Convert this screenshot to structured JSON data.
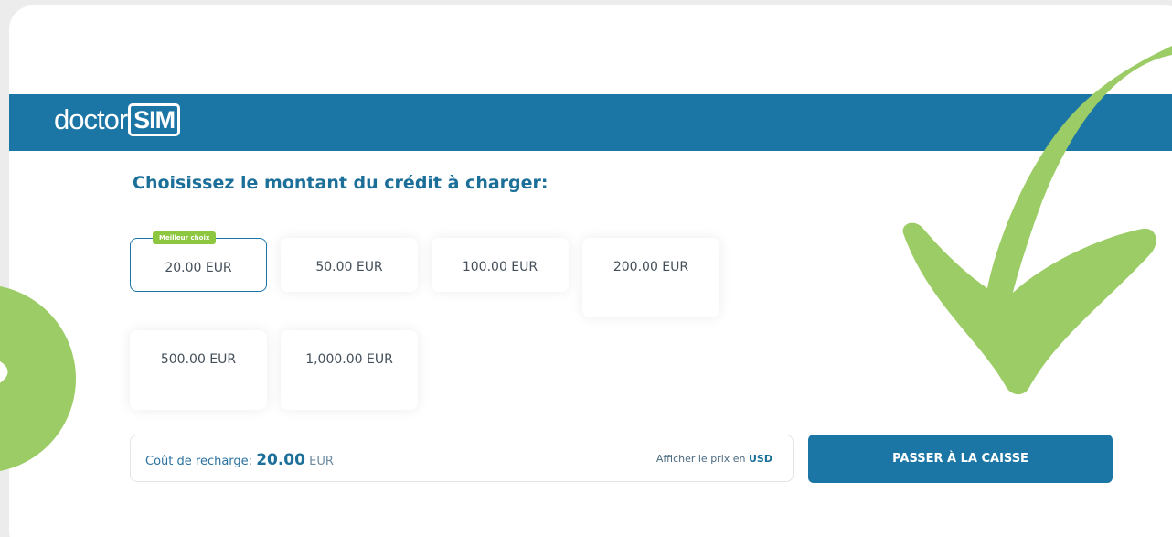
{
  "brand": {
    "name_plain": "doctor",
    "name_boxed": "SIM"
  },
  "heading": "Choisissez le montant du crédit à charger:",
  "amounts": [
    {
      "label": "20.00 EUR",
      "badge": "Meilleur choix",
      "selected": true
    },
    {
      "label": "50.00 EUR"
    },
    {
      "label": "100.00 EUR"
    },
    {
      "label": "200.00 EUR"
    },
    {
      "label": "500.00 EUR"
    },
    {
      "label": "1,000.00 EUR"
    }
  ],
  "cost": {
    "label": "Coût de recharge:",
    "value": "20.00",
    "currency": "EUR"
  },
  "price_link": {
    "prefix": "Afficher le prix en",
    "currency": "USD"
  },
  "checkout_label": "PASSER À LA CAISSE",
  "icons": {
    "checkmark": "checkmark-icon",
    "circle": "green-circle-decoration"
  },
  "colors": {
    "brand_blue": "#1c76a5",
    "heading_blue": "#1b6f99",
    "accent_green": "#8dc63f",
    "decoration_green": "#9ccc65"
  }
}
